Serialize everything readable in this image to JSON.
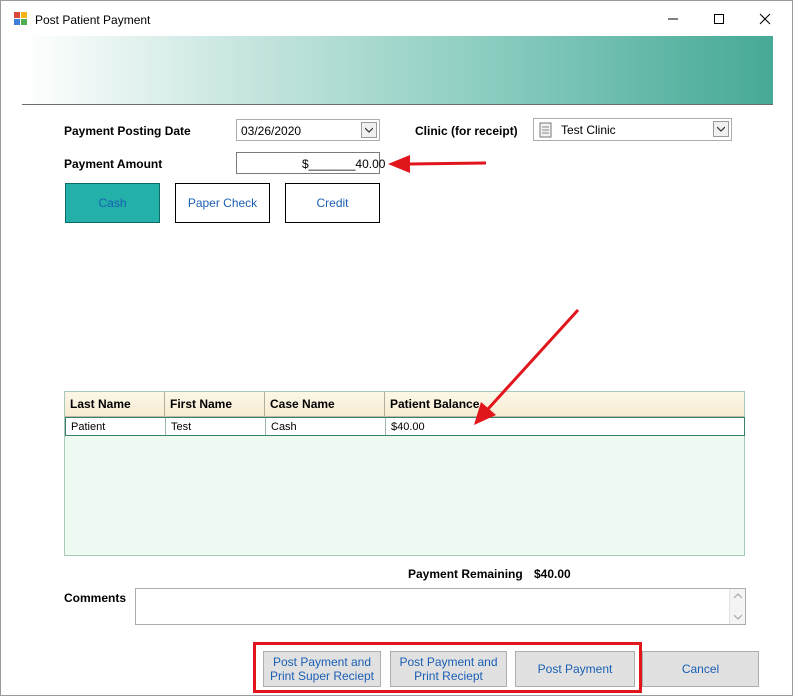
{
  "window": {
    "title": "Post Patient Payment",
    "accent_color": "#23b0a8",
    "annotation_color": "#e0161c"
  },
  "form": {
    "posting_date_label": "Payment Posting Date",
    "posting_date_value": "03/26/2020",
    "clinic_label": "Clinic (for receipt)",
    "clinic_value": "Test Clinic",
    "amount_label": "Payment Amount",
    "amount_value": "$_______40.00"
  },
  "payment_methods": [
    {
      "label": "Cash",
      "selected": true
    },
    {
      "label": "Paper Check",
      "selected": false
    },
    {
      "label": "Credit",
      "selected": false
    }
  ],
  "grid": {
    "columns": [
      "Last Name",
      "First Name",
      "Case Name",
      "Patient Balance"
    ],
    "rows": [
      [
        "Patient",
        "Test",
        "Cash",
        "$40.00"
      ]
    ]
  },
  "summary": {
    "remaining_label": "Payment Remaining",
    "remaining_value": "$40.00"
  },
  "comments": {
    "label": "Comments",
    "value": ""
  },
  "buttons": {
    "post_print_super": "Post Payment and\nPrint Super Reciept",
    "post_print": "Post Payment and\nPrint Reciept",
    "post": "Post Payment",
    "cancel": "Cancel"
  }
}
